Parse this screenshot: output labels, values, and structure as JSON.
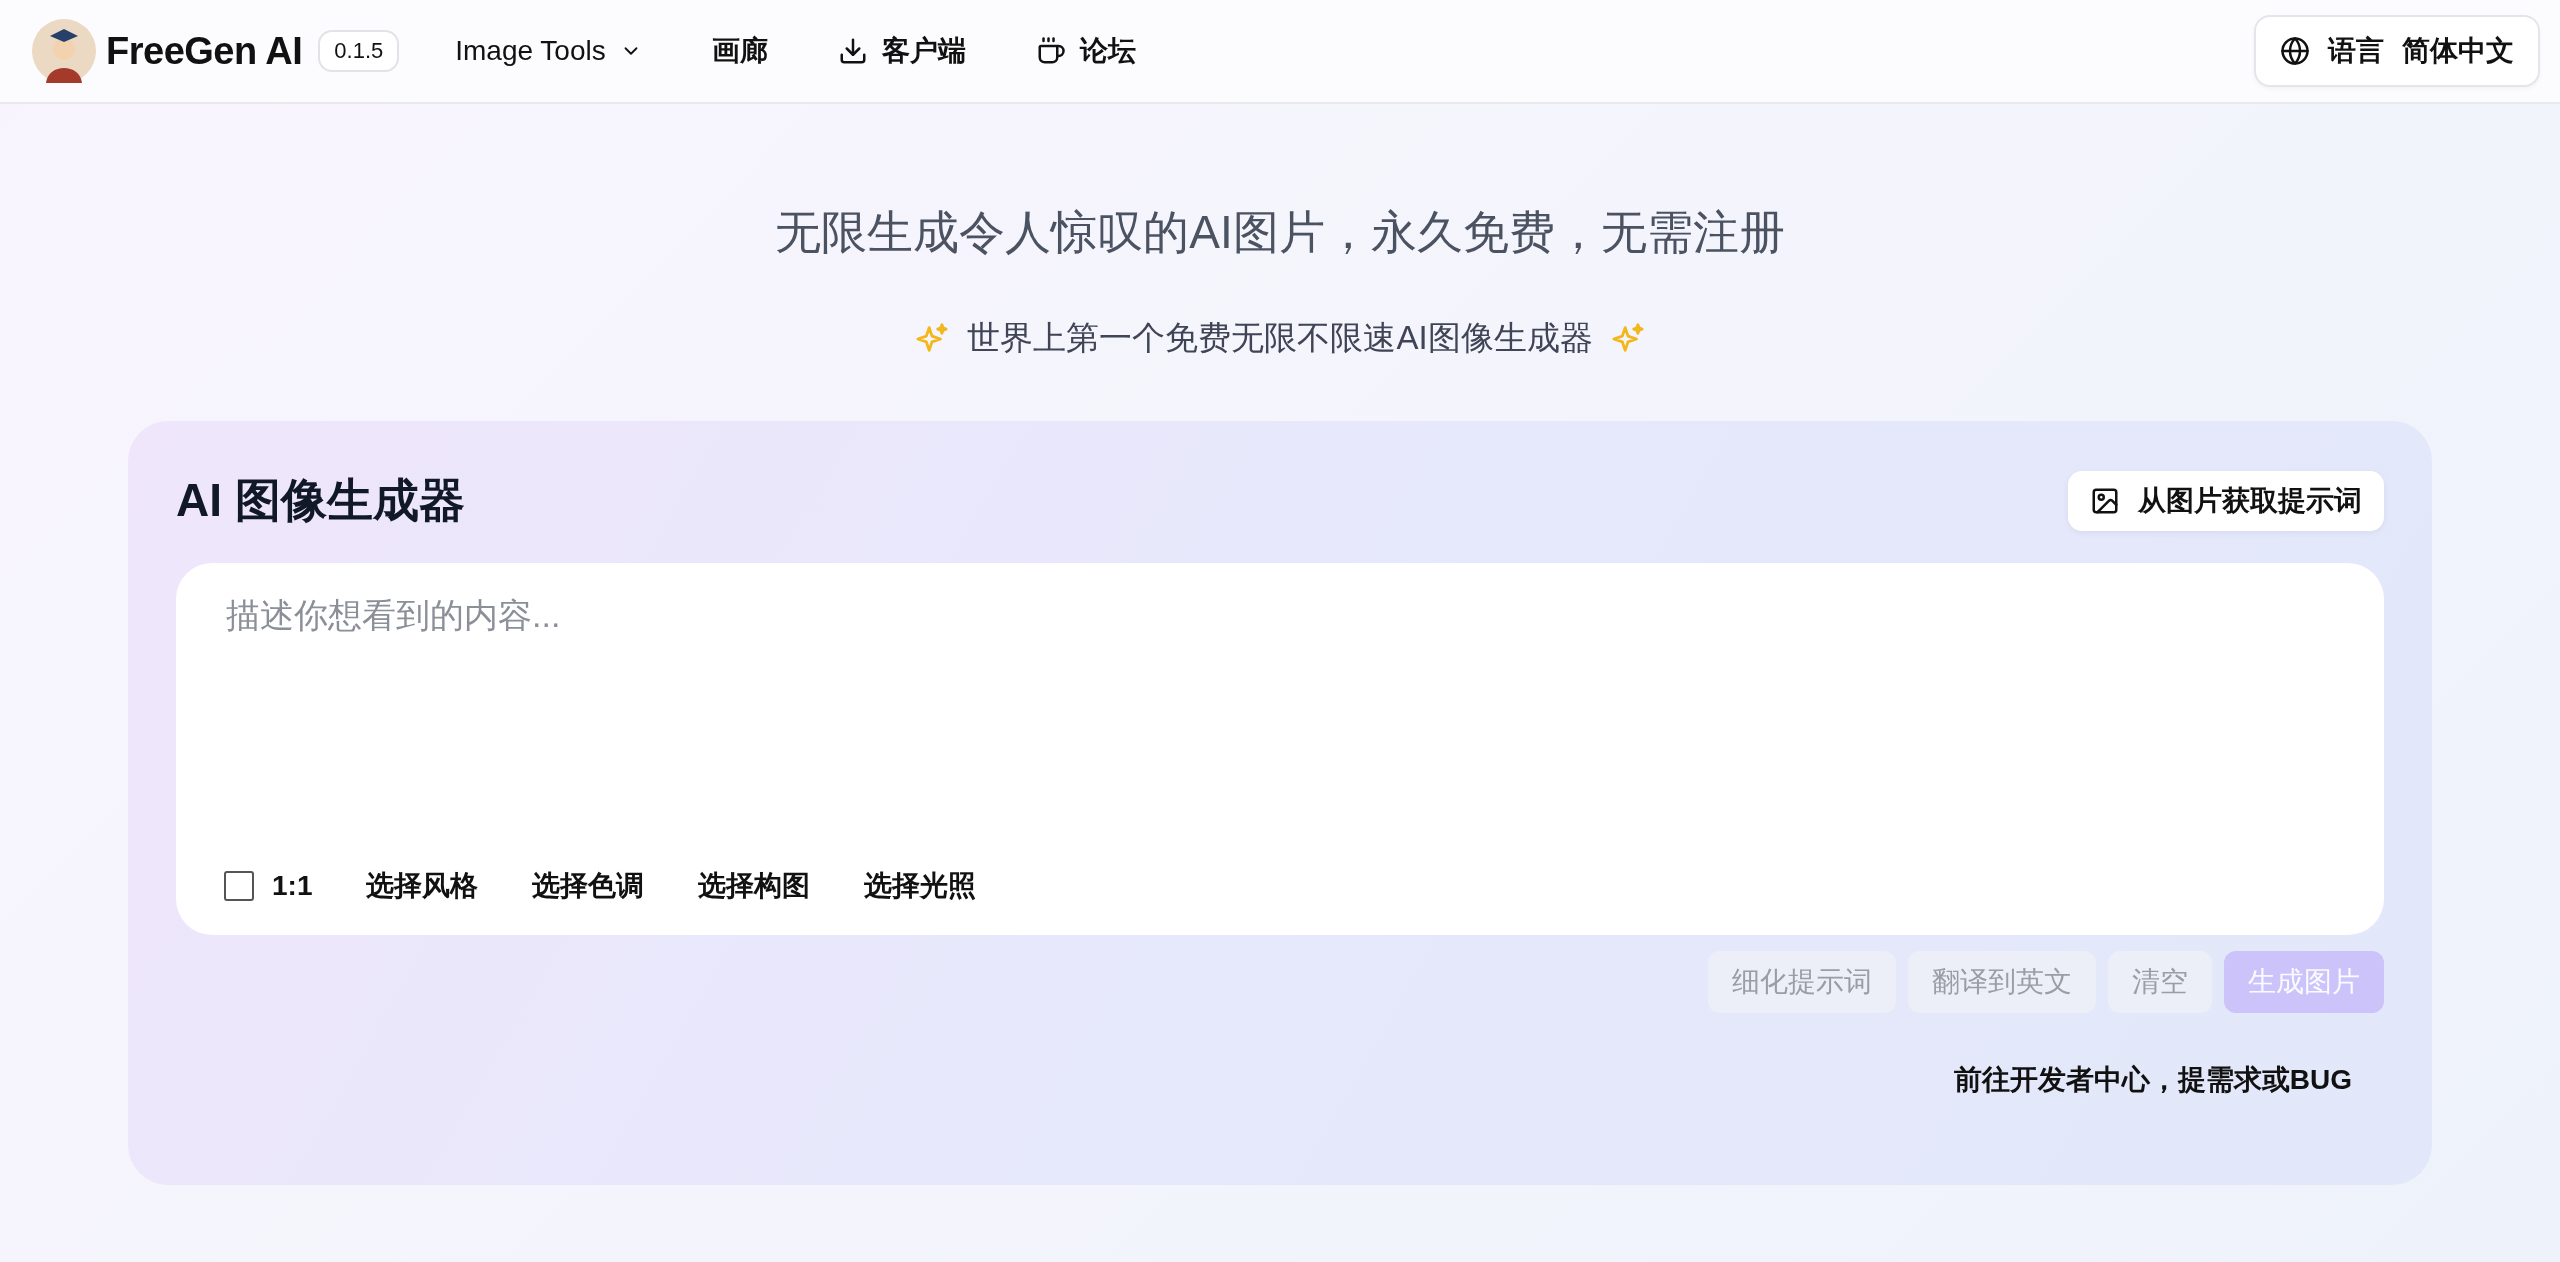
{
  "header": {
    "brand": "FreeGen AI",
    "version": "0.1.5",
    "nav": [
      {
        "label": "Image Tools",
        "kind": "dropdown"
      },
      {
        "label": "画廊",
        "kind": "plain"
      },
      {
        "label": "客户端",
        "kind": "download"
      },
      {
        "label": "论坛",
        "kind": "cup"
      }
    ],
    "language": {
      "label": "语言",
      "value": "简体中文"
    }
  },
  "hero": {
    "title": "无限生成令人惊叹的AI图片，永久免费，无需注册",
    "subtitle": "世界上第一个免费无限不限速AI图像生成器"
  },
  "generator": {
    "title": "AI 图像生成器",
    "image_prompt_button": "从图片获取提示词",
    "prompt": {
      "placeholder": "描述你想看到的内容..."
    },
    "options": [
      {
        "kind": "checkbox",
        "label": "1:1",
        "checked": false
      },
      {
        "kind": "menu",
        "label": "选择风格"
      },
      {
        "kind": "menu",
        "label": "选择色调"
      },
      {
        "kind": "menu",
        "label": "选择构图"
      },
      {
        "kind": "menu",
        "label": "选择光照"
      }
    ],
    "actions": [
      {
        "label": "细化提示词",
        "kind": "secondary",
        "disabled": true
      },
      {
        "label": "翻译到英文",
        "kind": "secondary",
        "disabled": true
      },
      {
        "label": "清空",
        "kind": "secondary",
        "disabled": true
      },
      {
        "label": "生成图片",
        "kind": "primary",
        "disabled": true
      }
    ],
    "developer_link": "前往开发者中心，提需求或BUG"
  }
}
